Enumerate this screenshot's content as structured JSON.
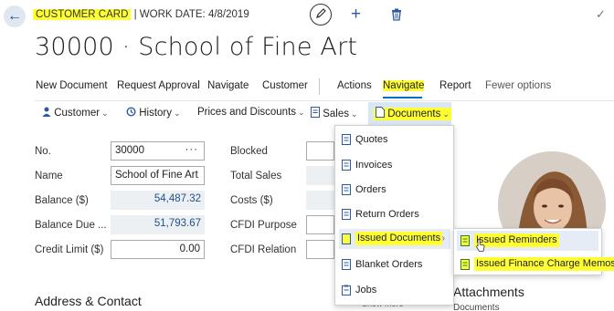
{
  "header": {
    "card_label": "CUSTOMER CARD",
    "work_date": " | WORK DATE: 4/8/2019",
    "title": "30000 · School of Fine Art"
  },
  "actions": {
    "new_document": "New Document",
    "request_approval": "Request Approval",
    "navigate": "Navigate",
    "customer": "Customer",
    "actions_tab": "Actions",
    "navigate_tab": "Navigate",
    "report": "Report",
    "fewer_options": "Fewer options"
  },
  "subactions": {
    "customer": "Customer",
    "history": "History",
    "prices_discounts": "Prices and Discounts",
    "sales": "Sales",
    "documents": "Documents"
  },
  "fields": {
    "no_label": "No.",
    "no_value": "30000",
    "name_label": "Name",
    "name_value": "School of Fine Art",
    "balance_label": "Balance ($)",
    "balance_value": "54,487.32",
    "balance_due_label": "Balance Due ...",
    "balance_due_value": "51,793.67",
    "credit_limit_label": "Credit Limit ($)",
    "credit_limit_value": "0.00",
    "blocked_label": "Blocked",
    "total_sales_label": "Total Sales",
    "costs_label": "Costs ($)",
    "cfdi_purpose_label": "CFDI Purpose",
    "cfdi_relation_label": "CFDI Relation"
  },
  "sections": {
    "address_contact": "Address & Contact",
    "show_more": "Show more",
    "attachments": "Attachments",
    "attachments_sub": "Documents"
  },
  "documents_menu": {
    "items": [
      "Quotes",
      "Invoices",
      "Orders",
      "Return Orders",
      "Issued Documents",
      "Blanket Orders",
      "Jobs"
    ],
    "submenu": [
      "Issued Reminders",
      "Issued Finance Charge Memos"
    ]
  },
  "colors": {
    "highlight": "#ffff33",
    "accent": "#0074c4",
    "readonly_value": "#1f4e8a"
  },
  "icons": [
    "back-arrow-icon",
    "pencil-icon",
    "plus-icon",
    "trash-icon",
    "checkmark-icon",
    "user-icon",
    "clock-icon",
    "document-icon",
    "ellipsis-icon",
    "chevron-down-icon",
    "chevron-right-icon",
    "pointer-cursor-icon"
  ]
}
